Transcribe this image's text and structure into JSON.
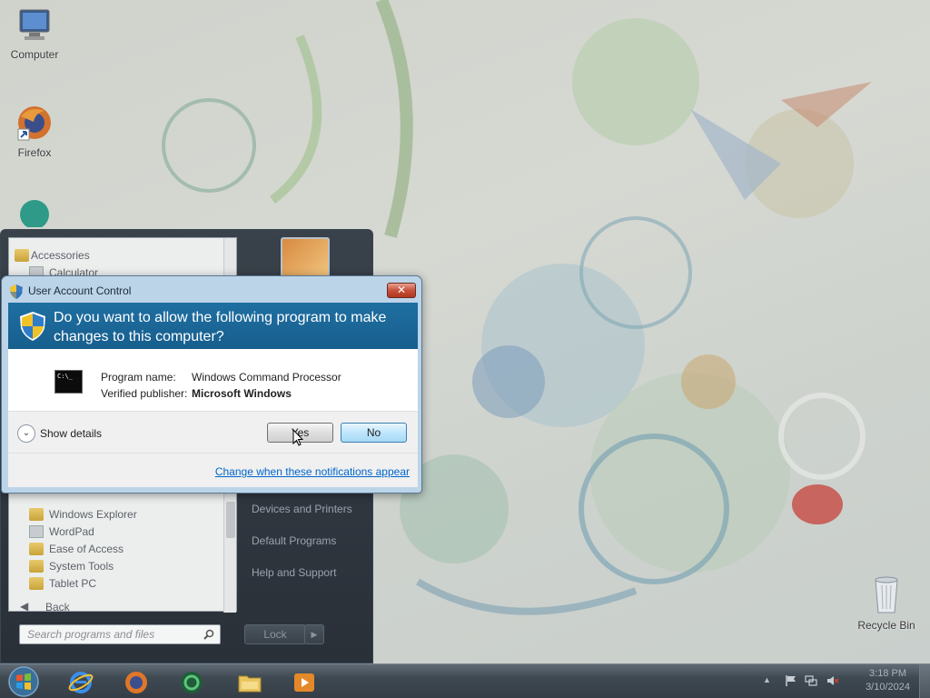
{
  "desktop": {
    "icons": [
      {
        "label": "Computer",
        "icon": "computer-icon"
      },
      {
        "label": "Firefox",
        "icon": "firefox-icon"
      },
      {
        "label": "Recycle Bin",
        "icon": "recycle-bin-icon"
      }
    ]
  },
  "start_menu": {
    "programs": [
      {
        "label": "Accessories",
        "icon": "folder-icon"
      },
      {
        "label": "Calculator",
        "icon": "calculator-icon"
      },
      {
        "label": "Windows Explorer",
        "icon": "explorer-icon"
      },
      {
        "label": "WordPad",
        "icon": "wordpad-icon"
      },
      {
        "label": "Ease of Access",
        "icon": "folder-icon"
      },
      {
        "label": "System Tools",
        "icon": "folder-icon"
      },
      {
        "label": "Tablet PC",
        "icon": "folder-icon"
      }
    ],
    "back_label": "Back",
    "search_placeholder": "Search programs and files",
    "right_items": [
      "Devices and Printers",
      "Default Programs",
      "Help and Support"
    ],
    "lock_label": "Lock"
  },
  "uac_dialog": {
    "title": "User Account Control",
    "question": "Do you want to allow the following program to make changes to this computer?",
    "program_name_label": "Program name:",
    "program_name": "Windows Command Processor",
    "publisher_label": "Verified publisher:",
    "publisher": "Microsoft Windows",
    "show_details": "Show details",
    "yes_label": "Yes",
    "no_label": "No",
    "change_link": "Change when these notifications appear",
    "cmd_icon_text": "C:\\_"
  },
  "taskbar": {
    "apps": [
      "internet-explorer-icon",
      "firefox-icon",
      "media-center-icon",
      "file-explorer-icon",
      "media-player-icon"
    ],
    "clock_time": "3:18 PM",
    "clock_date": "3/10/2024"
  },
  "colors": {
    "uac_banner": "#1f6fa2",
    "link": "#0066cc",
    "taskbar": "#3f4952"
  }
}
